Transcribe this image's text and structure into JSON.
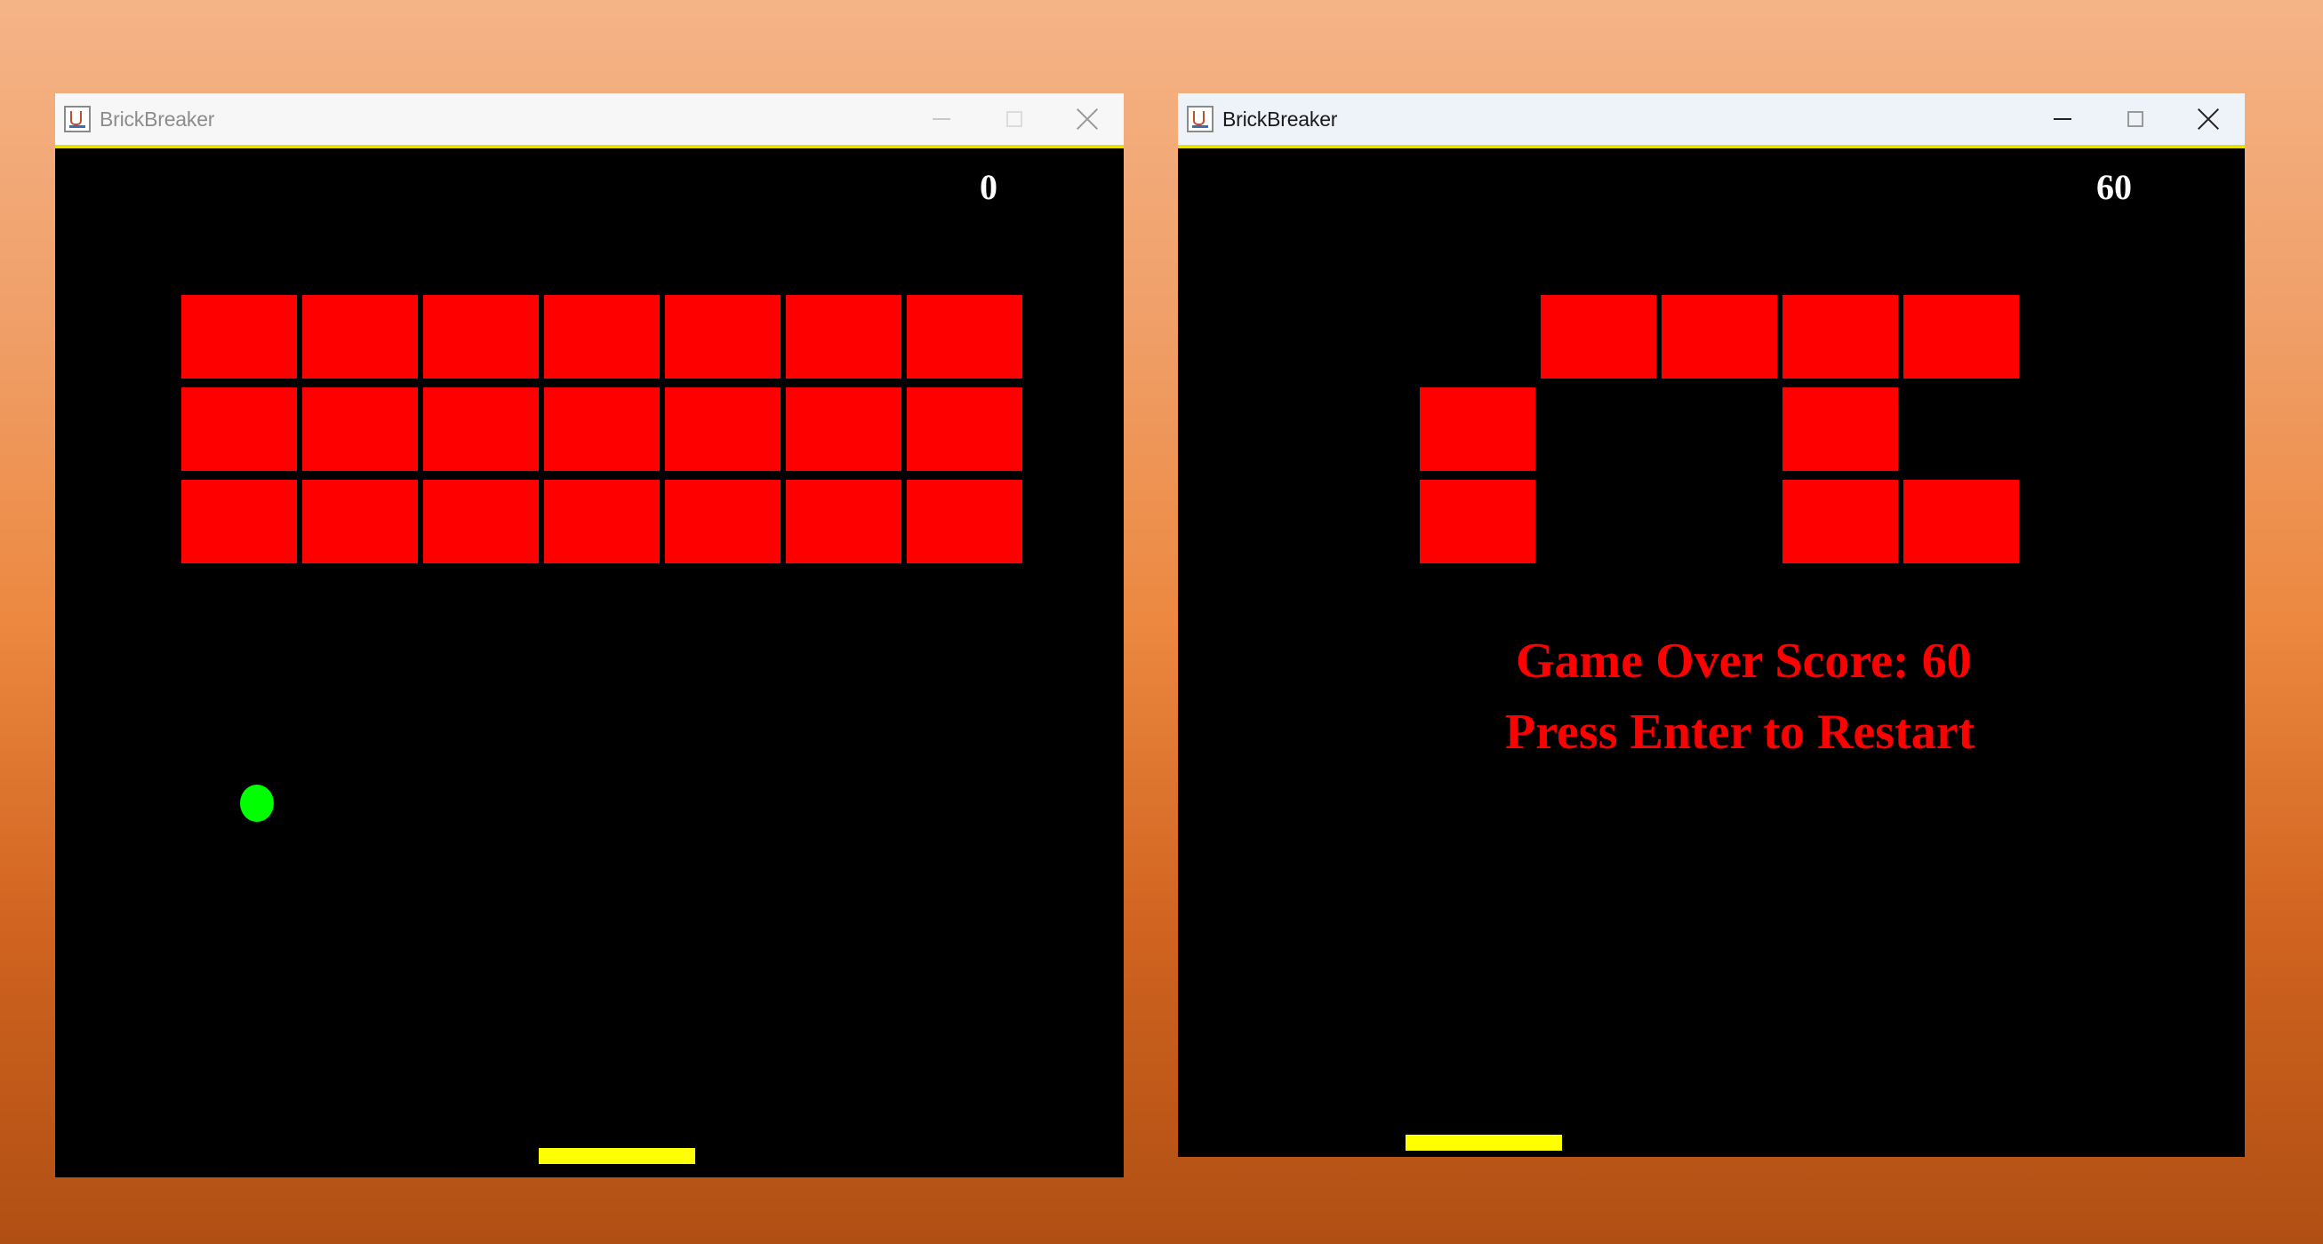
{
  "left_window": {
    "title": "BrickBreaker",
    "score": "0",
    "bricks": [
      [
        1,
        1,
        1,
        1,
        1,
        1,
        1
      ],
      [
        1,
        1,
        1,
        1,
        1,
        1,
        1
      ],
      [
        1,
        1,
        1,
        1,
        1,
        1,
        1
      ]
    ],
    "ball_visible": true
  },
  "right_window": {
    "title": "BrickBreaker",
    "score": "60",
    "bricks": [
      [
        0,
        1,
        1,
        1,
        1
      ],
      [
        1,
        0,
        0,
        1,
        0
      ],
      [
        1,
        0,
        0,
        1,
        1
      ]
    ],
    "game_over_text": "Game Over Score: 60",
    "restart_text": "Press Enter to Restart"
  },
  "colors": {
    "brick": "#ff0000",
    "ball": "#00ff00",
    "paddle": "#ffff00",
    "background": "#000000",
    "score_text": "#ffffff",
    "game_over_text": "#ff0000"
  },
  "icons": {
    "app": "java-app-icon",
    "minimize": "minimize-icon",
    "maximize": "maximize-icon",
    "close": "close-icon"
  }
}
